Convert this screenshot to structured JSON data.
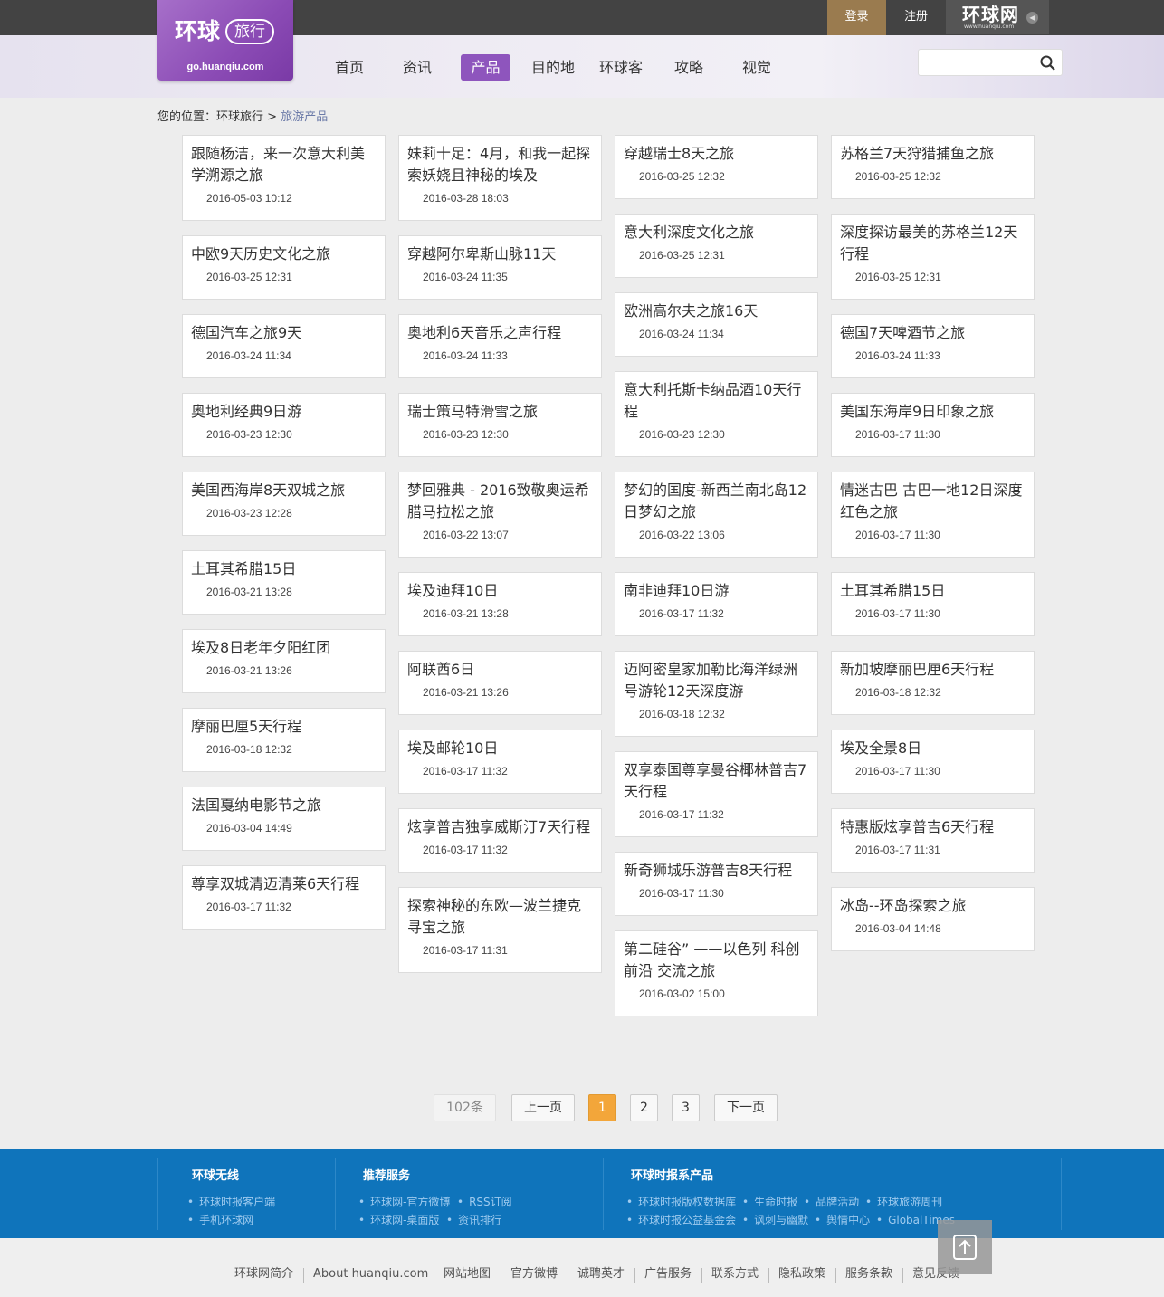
{
  "header": {
    "login": "登录",
    "register": "注册",
    "brand": {
      "name": "环球网",
      "domain": "www.huanqiu.com"
    },
    "logo": {
      "main": "环球",
      "tag": "旅行",
      "url": "go.huanqiu.com"
    },
    "nav": [
      "首页",
      "资讯",
      "产品",
      "目的地",
      "环球客",
      "攻略",
      "视觉"
    ],
    "nav_active": "产品",
    "search": {
      "placeholder": ""
    }
  },
  "breadcrumb": {
    "prefix": "您的位置：",
    "home": "环球旅行",
    "sep": ">",
    "current": "旅游产品"
  },
  "columns": [
    [
      {
        "title": "跟随杨洁，来一次意大利美学溯源之旅",
        "date": "2016-05-03 10:12"
      },
      {
        "title": "中欧9天历史文化之旅",
        "date": "2016-03-25 12:31"
      },
      {
        "title": "德国汽车之旅9天",
        "date": "2016-03-24 11:34"
      },
      {
        "title": "奥地利经典9日游",
        "date": "2016-03-23 12:30"
      },
      {
        "title": "美国西海岸8天双城之旅",
        "date": "2016-03-23 12:28"
      },
      {
        "title": "土耳其希腊15日",
        "date": "2016-03-21 13:28"
      },
      {
        "title": "埃及8日老年夕阳红团",
        "date": "2016-03-21 13:26"
      },
      {
        "title": "摩丽巴厘5天行程",
        "date": "2016-03-18 12:32"
      },
      {
        "title": "法国戛纳电影节之旅",
        "date": "2016-03-04 14:49"
      },
      {
        "title": "尊享双城清迈清莱6天行程",
        "date": "2016-03-17 11:32"
      }
    ],
    [
      {
        "title": "妹莉十足：4月，和我一起探索妖娆且神秘的埃及",
        "date": "2016-03-28 18:03"
      },
      {
        "title": "穿越阿尔卑斯山脉11天",
        "date": "2016-03-24 11:35"
      },
      {
        "title": "奥地利6天音乐之声行程",
        "date": "2016-03-24 11:33"
      },
      {
        "title": "瑞士策马特滑雪之旅",
        "date": "2016-03-23 12:30"
      },
      {
        "title": "梦回雅典 - 2016致敬奥运希腊马拉松之旅",
        "date": "2016-03-22 13:07"
      },
      {
        "title": "埃及迪拜10日",
        "date": "2016-03-21 13:28"
      },
      {
        "title": "阿联酋6日",
        "date": "2016-03-21 13:26"
      },
      {
        "title": "埃及邮轮10日",
        "date": "2016-03-17 11:32"
      },
      {
        "title": "炫享普吉独享威斯汀7天行程",
        "date": "2016-03-17 11:32"
      },
      {
        "title": "探索神秘的东欧—波兰捷克寻宝之旅",
        "date": "2016-03-17 11:31"
      }
    ],
    [
      {
        "title": "穿越瑞士8天之旅",
        "date": "2016-03-25 12:32"
      },
      {
        "title": "意大利深度文化之旅",
        "date": "2016-03-25 12:31"
      },
      {
        "title": "欧洲高尔夫之旅16天",
        "date": "2016-03-24 11:34"
      },
      {
        "title": "意大利托斯卡纳品酒10天行程",
        "date": "2016-03-23 12:30"
      },
      {
        "title": "梦幻的国度-新西兰南北岛12日梦幻之旅",
        "date": "2016-03-22 13:06"
      },
      {
        "title": "南非迪拜10日游",
        "date": "2016-03-17 11:32"
      },
      {
        "title": "迈阿密皇家加勒比海洋绿洲号游轮12天深度游",
        "date": "2016-03-18 12:32"
      },
      {
        "title": "双享泰国尊享曼谷椰林普吉7天行程",
        "date": "2016-03-17 11:32"
      },
      {
        "title": "新奇狮城乐游普吉8天行程",
        "date": "2016-03-17 11:30"
      },
      {
        "title": "第二硅谷” ——以色列 科创前沿 交流之旅",
        "date": "2016-03-02 15:00"
      }
    ],
    [
      {
        "title": "苏格兰7天狩猎捕鱼之旅",
        "date": "2016-03-25 12:32"
      },
      {
        "title": "深度探访最美的苏格兰12天行程",
        "date": "2016-03-25 12:31"
      },
      {
        "title": "德国7天啤酒节之旅",
        "date": "2016-03-24 11:33"
      },
      {
        "title": "美国东海岸9日印象之旅",
        "date": "2016-03-17 11:30"
      },
      {
        "title": "情迷古巴 古巴一地12日深度红色之旅",
        "date": "2016-03-17 11:30"
      },
      {
        "title": "土耳其希腊15日",
        "date": "2016-03-17 11:30"
      },
      {
        "title": "新加坡摩丽巴厘6天行程",
        "date": "2016-03-18 12:32"
      },
      {
        "title": "埃及全景8日",
        "date": "2016-03-17 11:30"
      },
      {
        "title": "特惠版炫享普吉6天行程",
        "date": "2016-03-17 11:31"
      },
      {
        "title": "冰岛--环岛探索之旅",
        "date": "2016-03-04 14:48"
      }
    ]
  ],
  "pagination": {
    "count": "102条",
    "prev": "上一页",
    "pages": [
      "1",
      "2",
      "3"
    ],
    "current": "1",
    "next": "下一页"
  },
  "footer": {
    "col1": {
      "title": "环球无线",
      "links": [
        "环球时报客户端",
        "手机环球网"
      ]
    },
    "col2": {
      "title": "推荐服务",
      "links": [
        "环球网-官方微博",
        "RSS订阅",
        "环球网-桌面版",
        "资讯排行"
      ]
    },
    "col3": {
      "title": "环球时报系产品",
      "links": [
        "环球时报版权数据库",
        "生命时报",
        "品牌活动",
        "环球旅游周刊",
        "环球时报公益基金会",
        "讽刺与幽默",
        "舆情中心",
        "GlobalTimes"
      ]
    },
    "bottom_links": [
      "环球网简介",
      "About huanqiu.com",
      "网站地图",
      "官方微博",
      "诚聘英才",
      "广告服务",
      "联系方式",
      "隐私政策",
      "服务条款",
      "意见反馈"
    ]
  },
  "colors": {
    "purple": "#8e55bd",
    "footer_blue": "#0f74bb",
    "page_active": "#f3a63a",
    "login_bg": "#9a7b4f"
  },
  "icons": {
    "search": "search-icon",
    "back_to_top": "back-to-top-icon",
    "brand_arrow": "arrow-left-icon"
  }
}
